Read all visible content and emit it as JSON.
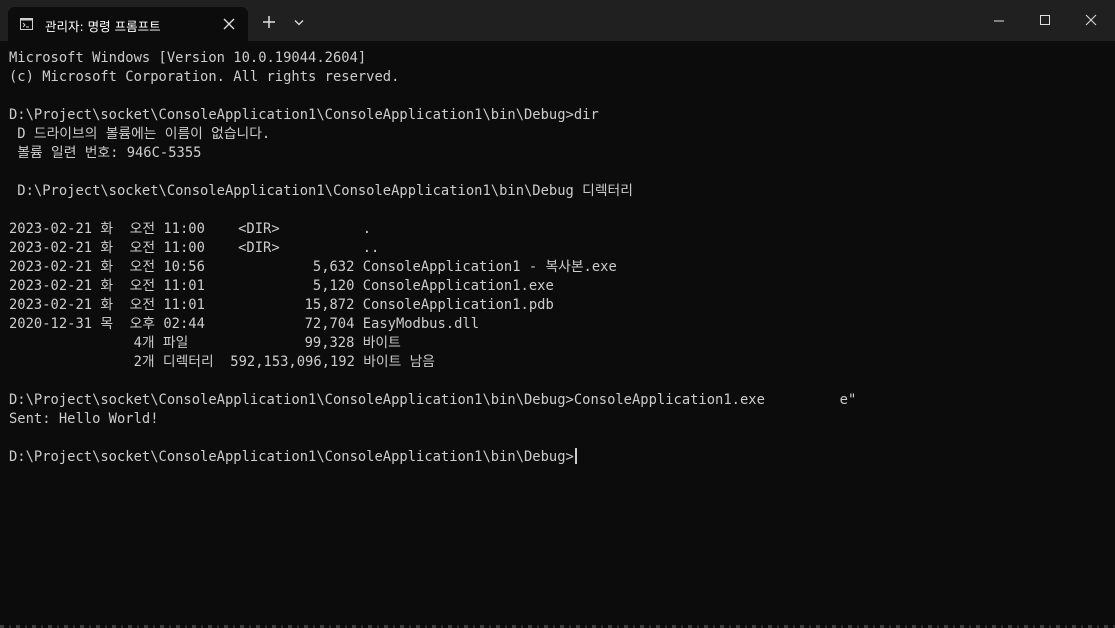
{
  "window": {
    "tab_title": "관리자: 명령 프롬프트",
    "icons": {
      "tab": "cmd-icon",
      "tab_close": "close-icon",
      "new_tab": "plus-icon",
      "dropdown": "chevron-down-icon",
      "minimize": "minimize-icon",
      "maximize": "maximize-icon",
      "close": "close-icon"
    }
  },
  "colors": {
    "background": "#0c0c0c",
    "titlebar": "#202020",
    "text": "#cccccc",
    "title_text": "#ffffff"
  },
  "console": {
    "lines": [
      "Microsoft Windows [Version 10.0.19044.2604]",
      "(c) Microsoft Corporation. All rights reserved.",
      "",
      "D:\\Project\\socket\\ConsoleApplication1\\ConsoleApplication1\\bin\\Debug>dir",
      " D 드라이브의 볼륨에는 이름이 없습니다.",
      " 볼륨 일련 번호: 946C-5355",
      "",
      " D:\\Project\\socket\\ConsoleApplication1\\ConsoleApplication1\\bin\\Debug 디렉터리",
      "",
      "2023-02-21 화  오전 11:00    <DIR>          .",
      "2023-02-21 화  오전 11:00    <DIR>          ..",
      "2023-02-21 화  오전 10:56             5,632 ConsoleApplication1 - 복사본.exe",
      "2023-02-21 화  오전 11:01             5,120 ConsoleApplication1.exe",
      "2023-02-21 화  오전 11:01            15,872 ConsoleApplication1.pdb",
      "2020-12-31 목  오후 02:44            72,704 EasyModbus.dll",
      "               4개 파일              99,328 바이트",
      "               2개 디렉터리  592,153,096,192 바이트 남음",
      "",
      "D:\\Project\\socket\\ConsoleApplication1\\ConsoleApplication1\\bin\\Debug>ConsoleApplication1.exe         e\"",
      "Sent: Hello World!",
      ""
    ],
    "prompt": "D:\\Project\\socket\\ConsoleApplication1\\ConsoleApplication1\\bin\\Debug>"
  }
}
